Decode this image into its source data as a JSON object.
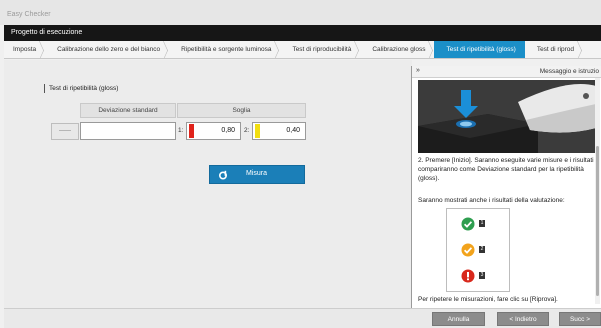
{
  "app": {
    "title": "Easy Checker"
  },
  "header": {
    "title": "Progetto di esecuzione"
  },
  "tabs": [
    {
      "label": "Imposta",
      "active": false
    },
    {
      "label": "Calibrazione dello zero e del bianco",
      "active": false
    },
    {
      "label": "Ripetibilità e sorgente luminosa",
      "active": false
    },
    {
      "label": "Test di riproducibilità",
      "active": false
    },
    {
      "label": "Calibrazione gloss",
      "active": false
    },
    {
      "label": "Test di ripetibilità (gloss)",
      "active": true
    },
    {
      "label": "Test di riprod",
      "active": false
    }
  ],
  "main": {
    "section_title": "Test di ripetibilità (gloss)",
    "col_std_dev": "Deviazione standard",
    "col_threshold": "Soglia",
    "row_placeholder": "------",
    "std_dev_value": "",
    "threshold_1_index": "1:",
    "threshold_1_value": "0,80",
    "threshold_1_color": "#e0231b",
    "threshold_2_index": "2:",
    "threshold_2_value": "0,40",
    "threshold_2_color": "#f2de10",
    "measure_label": "Misura",
    "measure_icon": "measure-icon"
  },
  "panel": {
    "toggle_icon": "»",
    "title": "Messaggio e istruzio",
    "step_text": "2. Premere [Inizio]. Saranno eseguite varie misure e i risultati compariranno come Deviazione standard per la ripetibilità (gloss).",
    "eval_text": "Saranno mostrati anche i risultati della valutazione:",
    "legend": [
      {
        "icon": "check-icon",
        "color": "#2e9e4f",
        "num": "1"
      },
      {
        "icon": "check-warning-icon",
        "color": "#f2a31c",
        "num": "2"
      },
      {
        "icon": "error-icon",
        "color": "#d8281c",
        "num": "3"
      }
    ],
    "retry_text": "Per ripetere le misurazioni, fare clic su [Riprova]."
  },
  "footer": {
    "cancel": "Annulla",
    "back": "< Indietro",
    "next": "Succ >"
  }
}
